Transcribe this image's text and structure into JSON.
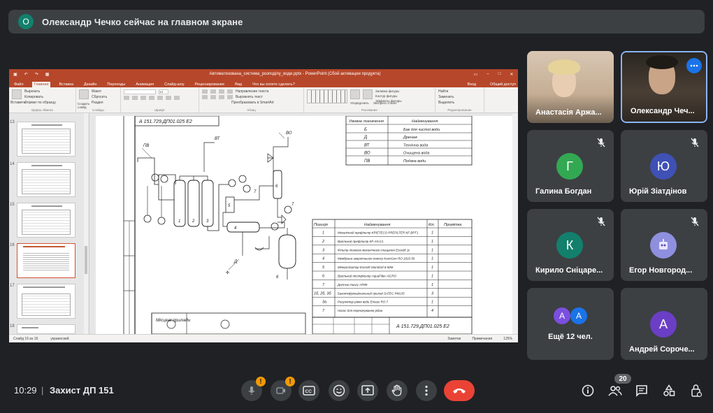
{
  "banner": {
    "avatar_letter": "О",
    "text": "Олександр Чечко сейчас на главном экране"
  },
  "screen": {
    "ppt": {
      "doc_title": "Автоматизована_система_розподілу_води.pptx - PowerPoint (Сбой активации продукта)",
      "tabs": [
        "Файл",
        "Главная",
        "Вставка",
        "Дизайн",
        "Переходы",
        "Анимация",
        "Слайд-шоу",
        "Рецензирование",
        "Вид",
        "Что вы хотите сделать?"
      ],
      "tabs_right": [
        "Вход",
        "Общий доступ"
      ],
      "ribbon_groups": [
        "Буфер обмена",
        "Слайды",
        "Шрифт",
        "Абзац",
        "Рисование",
        "Редактирование"
      ],
      "ribbon_labels": {
        "paste": "Вставить",
        "cut": "Вырезать",
        "copy": "Копировать",
        "format": "Формат по образцу",
        "new_slide": "Создать слайд",
        "layout": "Макет",
        "reset": "Сбросить",
        "section": "Раздел",
        "font_size": "14",
        "text_dir": "Направление текста",
        "align_text": "Выровнять текст",
        "smartart": "Преобразовать в SmartArt",
        "arrange": "Упорядочить",
        "quick_styles": "Экспресс-стили",
        "fill": "Заливка фигуры",
        "outline": "Контур фигуры",
        "effects": "Эффекты фигуры",
        "find": "Найти",
        "replace": "Заменить",
        "select": "Выделить"
      },
      "slide_numbers": [
        "13",
        "14",
        "15",
        "16",
        "17",
        "18"
      ],
      "thumb_captions": [
        "Опис шифрів ДП",
        "Опис шифрів ДП",
        "Опис шифрів ДП",
        "Функціональна схема автоматизації",
        "Перелік засобів автоматизації",
        "Висновки"
      ],
      "status": {
        "slide": "Слайд 16 из 16",
        "lang": "украинский",
        "notes": "Заметки",
        "comments": "Примечания",
        "zoom": "125%"
      }
    },
    "drawing": {
      "stamp": "А 151.729.ДП01.025 Е2",
      "stamp_bottom": "А 151.729.ДП01.025 Е2",
      "legend_headers": [
        "Умовне позначення",
        "Найменування"
      ],
      "legend_rows": [
        [
          "Б",
          "Бак для чистої води"
        ],
        [
          "Д",
          "Дренаж"
        ],
        [
          "ВТ",
          "Технічна вода"
        ],
        [
          "ВО",
          "Очищена вода"
        ],
        [
          "ПВ",
          "Подача води"
        ]
      ],
      "pos_headers": [
        "Позиція",
        "Найменування",
        "Кіл.",
        "Примітка"
      ],
      "pos_rows": [
        [
          "1",
          "Механічний префільтр KRIETECO PREFILTER KF-BPT1",
          "1"
        ],
        [
          "2",
          "Вугільний префільтр KF-AN.C1",
          "1"
        ],
        [
          "3",
          "Фільтр тонкого механічного очищення Ecosoft 1c",
          "1"
        ],
        [
          "4",
          "Мембрана зворотнього осмосу KeenGen RO-1810-50",
          "1"
        ],
        [
          "5",
          "Мінералізатор Ecosoft Standard 6-50M",
          "1"
        ],
        [
          "6",
          "Вугільний постфільтр AquaFilter AICRO",
          "1"
        ],
        [
          "7",
          "Датчик тиску ATM9",
          "1"
        ],
        [
          "1б, 2б, 3б",
          "Багатофункціональний прилад SATEC PM135",
          "3"
        ],
        [
          "3а",
          "Регулятор рівня води Emaux RO-7",
          "1"
        ],
        [
          "7",
          "Насос для перекачування рідин",
          "4"
        ]
      ],
      "flow_labels": [
        "ПВ",
        "ВТ",
        "ВО",
        "Д"
      ],
      "side_texts": [
        "Місцеві прилади"
      ]
    }
  },
  "participants": [
    {
      "name": "Анастасія Аржа...",
      "type": "video",
      "muted": false
    },
    {
      "name": "Олександр Чеч...",
      "type": "video",
      "muted": false,
      "active": true
    },
    {
      "name": "Галина Богдан",
      "letter": "Г",
      "color": "#33a852",
      "muted": true
    },
    {
      "name": "Юрій Зіатдінов",
      "letter": "Ю",
      "color": "#3f51b5",
      "muted": true
    },
    {
      "name": "Кирило Сніцаре...",
      "letter": "К",
      "color": "#12806c",
      "muted": true
    },
    {
      "name": "Егор Новгород...",
      "letter": "",
      "color": "#8f8fdf",
      "muted": true
    },
    {
      "name": "Ещё 12 чел.",
      "type": "more",
      "letters": [
        "А",
        "А"
      ]
    },
    {
      "name": "Андрей Сороче...",
      "letter": "А",
      "color": "#6a3fc5",
      "muted": false
    }
  ],
  "bottom": {
    "time": "10:29",
    "separator": "|",
    "meeting": "Захист ДП 151",
    "people_count": "20"
  },
  "colors": {
    "bg": "#202124",
    "tile": "#3c4043",
    "end_call": "#ea4335",
    "warn": "#f29900",
    "ppt": "#b7472a"
  },
  "icons": [
    "mic-off-icon",
    "camera-off-icon",
    "captions-icon",
    "emoji-icon",
    "present-icon",
    "raise-hand-icon",
    "more-vert-icon",
    "end-call-icon",
    "info-icon",
    "people-icon",
    "chat-icon",
    "activities-icon",
    "host-controls-icon"
  ]
}
